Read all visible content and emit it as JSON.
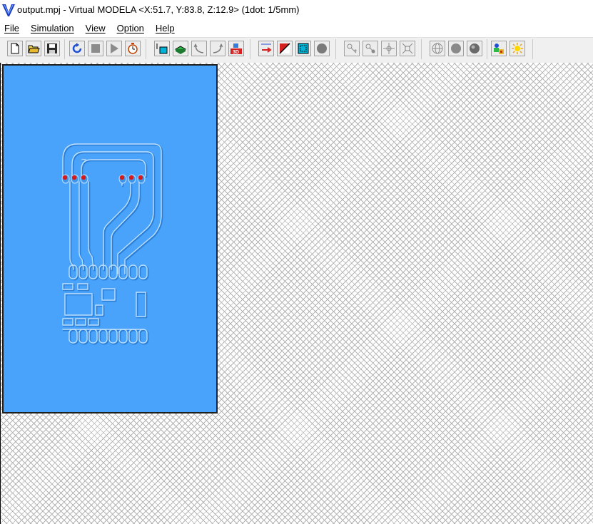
{
  "window": {
    "title": "output.mpj - Virtual MODELA <X:51.7, Y:83.8, Z:12.9> (1dot: 1/5mm)",
    "app_icon": "v-logo-icon"
  },
  "menubar": {
    "items": [
      "File",
      "Simulation",
      "View",
      "Option",
      "Help"
    ]
  },
  "toolbar": {
    "groups": [
      [
        "new-document-icon",
        "open-folder-icon",
        "save-disk-icon"
      ],
      [
        "play-loop-icon",
        "stop-icon",
        "play-icon",
        "timer-clock-icon"
      ],
      [
        "top-view-icon",
        "solid-view-icon",
        "arc-left-icon",
        "arc-right-icon",
        "3d-view-icon"
      ],
      [
        "fit-arrow-icon",
        "flip-icon",
        "frame-view-icon",
        "circle-view-icon"
      ],
      [
        "node-add-icon",
        "node-move-icon",
        "node-expand-icon",
        "node-shrink-icon"
      ],
      [
        "sphere-wire-icon",
        "sphere-solid-icon",
        "sphere-shaded-icon"
      ],
      [
        "color-palette-icon",
        "light-sun-icon"
      ]
    ]
  },
  "colors": {
    "board": "#4aa3fb",
    "board_edge": "#1f1f1f",
    "trace_highlight": "#bfe0ff",
    "trace_shadow": "#2b7fd6",
    "pad_hole": "#d61a1a",
    "workspace_hatch": "#b4b4b4"
  }
}
